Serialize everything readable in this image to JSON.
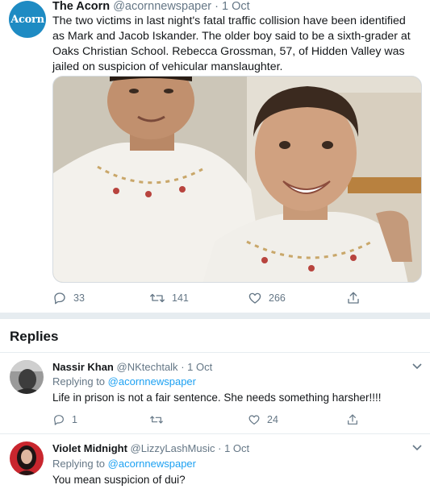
{
  "tweet": {
    "avatar_text": "Acorn",
    "name": "The Acorn",
    "handle": "@acornnewspaper",
    "date": "1 Oct",
    "text": "The two victims in last night's fatal traffic collision have been identified as Mark and Jacob Iskander. The older boy said to be a sixth-grader at Oaks Christian School. Rebecca Grossman, 57, of Hidden Valley was jailed on suspicion of vehicular manslaughter.",
    "replies_count": "33",
    "retweets_count": "141",
    "likes_count": "266"
  },
  "replies_section": {
    "title": "Replies"
  },
  "replies": [
    {
      "name": "Nassir Khan",
      "handle": "@NKtechtalk",
      "date": "1 Oct",
      "replying_label": "Replying to",
      "replying_handle": "@acornnewspaper",
      "text": "Life in prison is not a fair sentence. She needs something harsher!!!!",
      "reply_count": "1",
      "retweet_count": "",
      "like_count": "24"
    },
    {
      "name": "Violet Midnight",
      "handle": "@LizzyLashMusic",
      "date": "1 Oct",
      "replying_label": "Replying to",
      "replying_handle": "@acornnewspaper",
      "text": "You mean suspicion of dui?"
    }
  ],
  "icons": {
    "reply": "reply-icon",
    "retweet": "retweet-icon",
    "like": "heart-icon",
    "share": "share-icon",
    "caret": "chevron-down-icon"
  },
  "colors": {
    "link": "#1da1f2",
    "muted": "#657786",
    "avatar_bg": "#1e8bc3"
  }
}
